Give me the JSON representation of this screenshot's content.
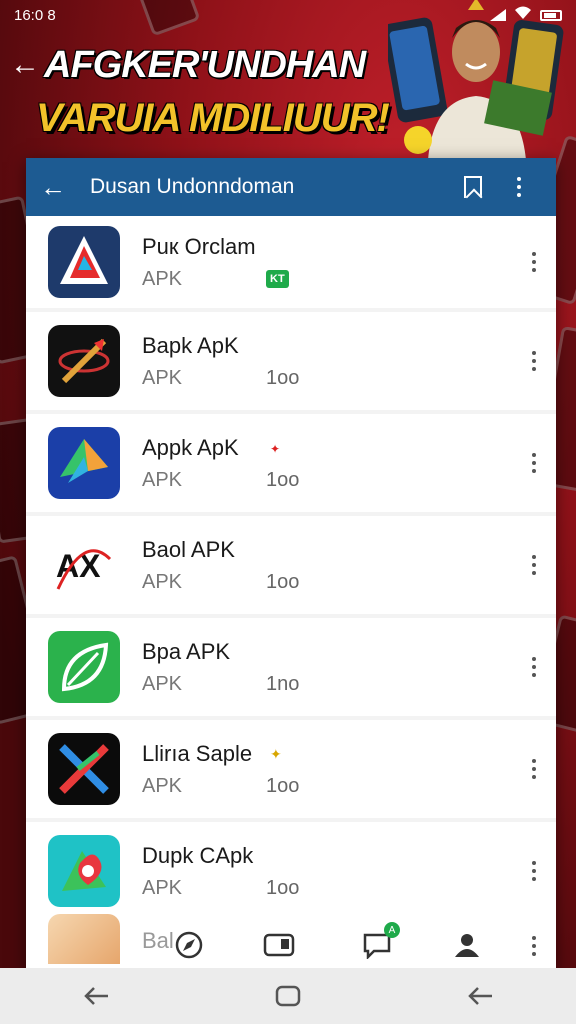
{
  "status_bar": {
    "time": "16:0 8"
  },
  "banner": {
    "title_line1": "AFGKER'UNDHAN",
    "title_line2": "VARUIA MDILIUUR!"
  },
  "app_bar": {
    "title": "Dusan Undonndoman"
  },
  "apps": [
    {
      "name": "Puк Orclam",
      "type": "APK",
      "count": "",
      "badge": "KT",
      "badge_color": "#1faa4a",
      "icon": "red-triangle-logo-icon",
      "icon_bg": "#1e3a6b"
    },
    {
      "name": "Bapk ApK",
      "type": "APK",
      "count": "1oo",
      "badge": "",
      "icon": "sword-logo-icon",
      "icon_bg": "#111111"
    },
    {
      "name": "Appk ApK",
      "type": "APK",
      "count": "1oo",
      "badge": "✦",
      "badge_color": "#dd2222",
      "icon": "folded-arrow-logo-icon",
      "icon_bg": "#1b3fa8"
    },
    {
      "name": "Baol APK",
      "type": "APK",
      "count": "1oo",
      "badge": "",
      "icon": "ax-logo-icon",
      "icon_bg": "#ffffff"
    },
    {
      "name": "Bpa APK",
      "type": "APK",
      "count": "1no",
      "badge": "",
      "icon": "leaf-logo-icon",
      "icon_bg": "#2bb24c"
    },
    {
      "name": "Llirıa Saple",
      "type": "APK",
      "count": "1oo",
      "badge": "✦",
      "badge_color": "#d8a600",
      "icon": "x-arrow-logo-icon",
      "icon_bg": "#0b0b0b"
    },
    {
      "name": "Dupk CApk",
      "type": "APK",
      "count": "1oo",
      "badge": "",
      "icon": "heart-map-logo-icon",
      "icon_bg": "#1fc2c6"
    }
  ],
  "partial_app": {
    "name": "Bal"
  }
}
